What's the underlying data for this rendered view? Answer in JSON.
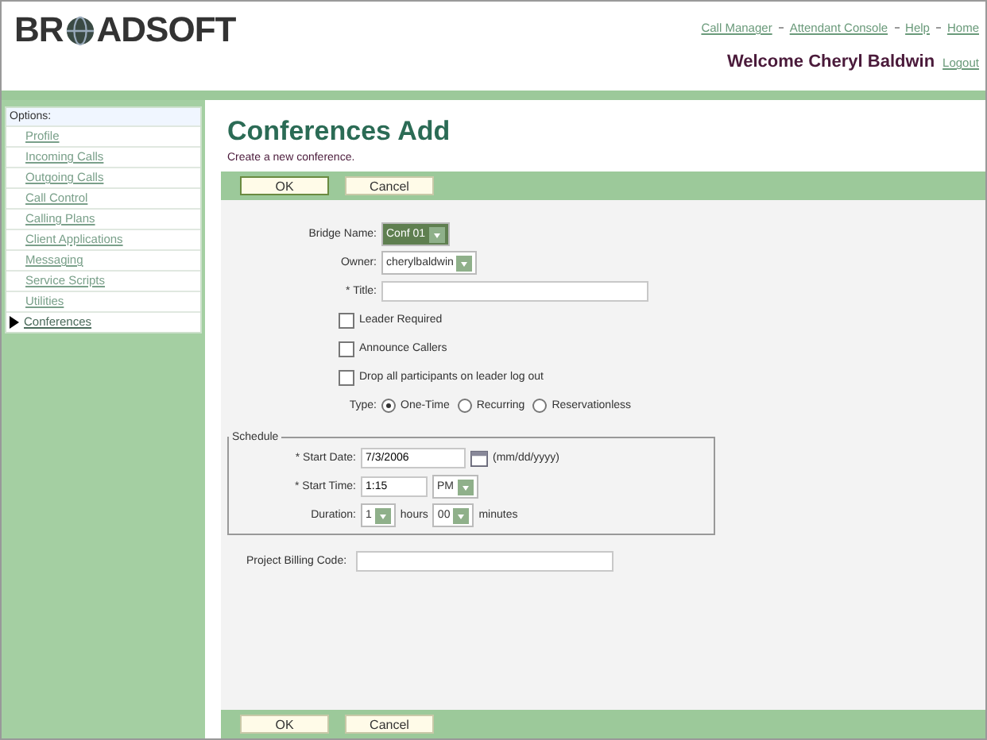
{
  "header": {
    "logo": [
      "BR",
      "ADSOFT"
    ],
    "links": [
      "Call Manager",
      "Attendant Console",
      "Help",
      "Home"
    ],
    "welcome": "Welcome Cheryl Baldwin",
    "logout": "Logout"
  },
  "sidebar": {
    "heading": "Options:",
    "items": [
      {
        "label": "Profile",
        "selected": false
      },
      {
        "label": "Incoming Calls",
        "selected": false
      },
      {
        "label": "Outgoing Calls",
        "selected": false
      },
      {
        "label": "Call Control",
        "selected": false
      },
      {
        "label": "Calling Plans",
        "selected": false
      },
      {
        "label": "Client Applications",
        "selected": false
      },
      {
        "label": "Messaging",
        "selected": false
      },
      {
        "label": "Service Scripts",
        "selected": false
      },
      {
        "label": "Utilities",
        "selected": false
      },
      {
        "label": "Conferences",
        "selected": true
      }
    ]
  },
  "page": {
    "title": "Conferences Add",
    "subtitle": "Create a new conference."
  },
  "top_buttons": [
    "OK",
    "Cancel"
  ],
  "form": {
    "bridge": {
      "label": "Bridge Name:",
      "value": "Conf 01"
    },
    "owner": {
      "label": "Owner:",
      "value": "cherylbaldwin"
    },
    "title": {
      "label": "* Title:"
    },
    "options": [
      {
        "label": "Leader Required",
        "checked": false
      },
      {
        "label": "Announce Callers",
        "checked": false
      },
      {
        "label": "Drop all participants on leader log out",
        "checked": false
      }
    ],
    "type": {
      "label": "Type:",
      "options": [
        {
          "label": "One-Time",
          "selected": true
        },
        {
          "label": "Recurring",
          "selected": false
        },
        {
          "label": "Reservationless",
          "selected": false
        }
      ]
    },
    "schedule": {
      "legend": "Schedule",
      "start_date": {
        "label": "* Start Date:",
        "value": "7/3/2006",
        "hint": "(mm/dd/yyyy)"
      },
      "start_time": {
        "label": "* Start Time:",
        "value": "1:15",
        "ampm": "PM"
      },
      "duration": {
        "label": "Duration:",
        "hours": "1",
        "hours_unit": "hours",
        "minutes": "00",
        "minutes_unit": "minutes"
      }
    },
    "billing": {
      "label": "Project Billing Code:"
    }
  },
  "bottom_buttons": [
    "OK",
    "Cancel"
  ]
}
